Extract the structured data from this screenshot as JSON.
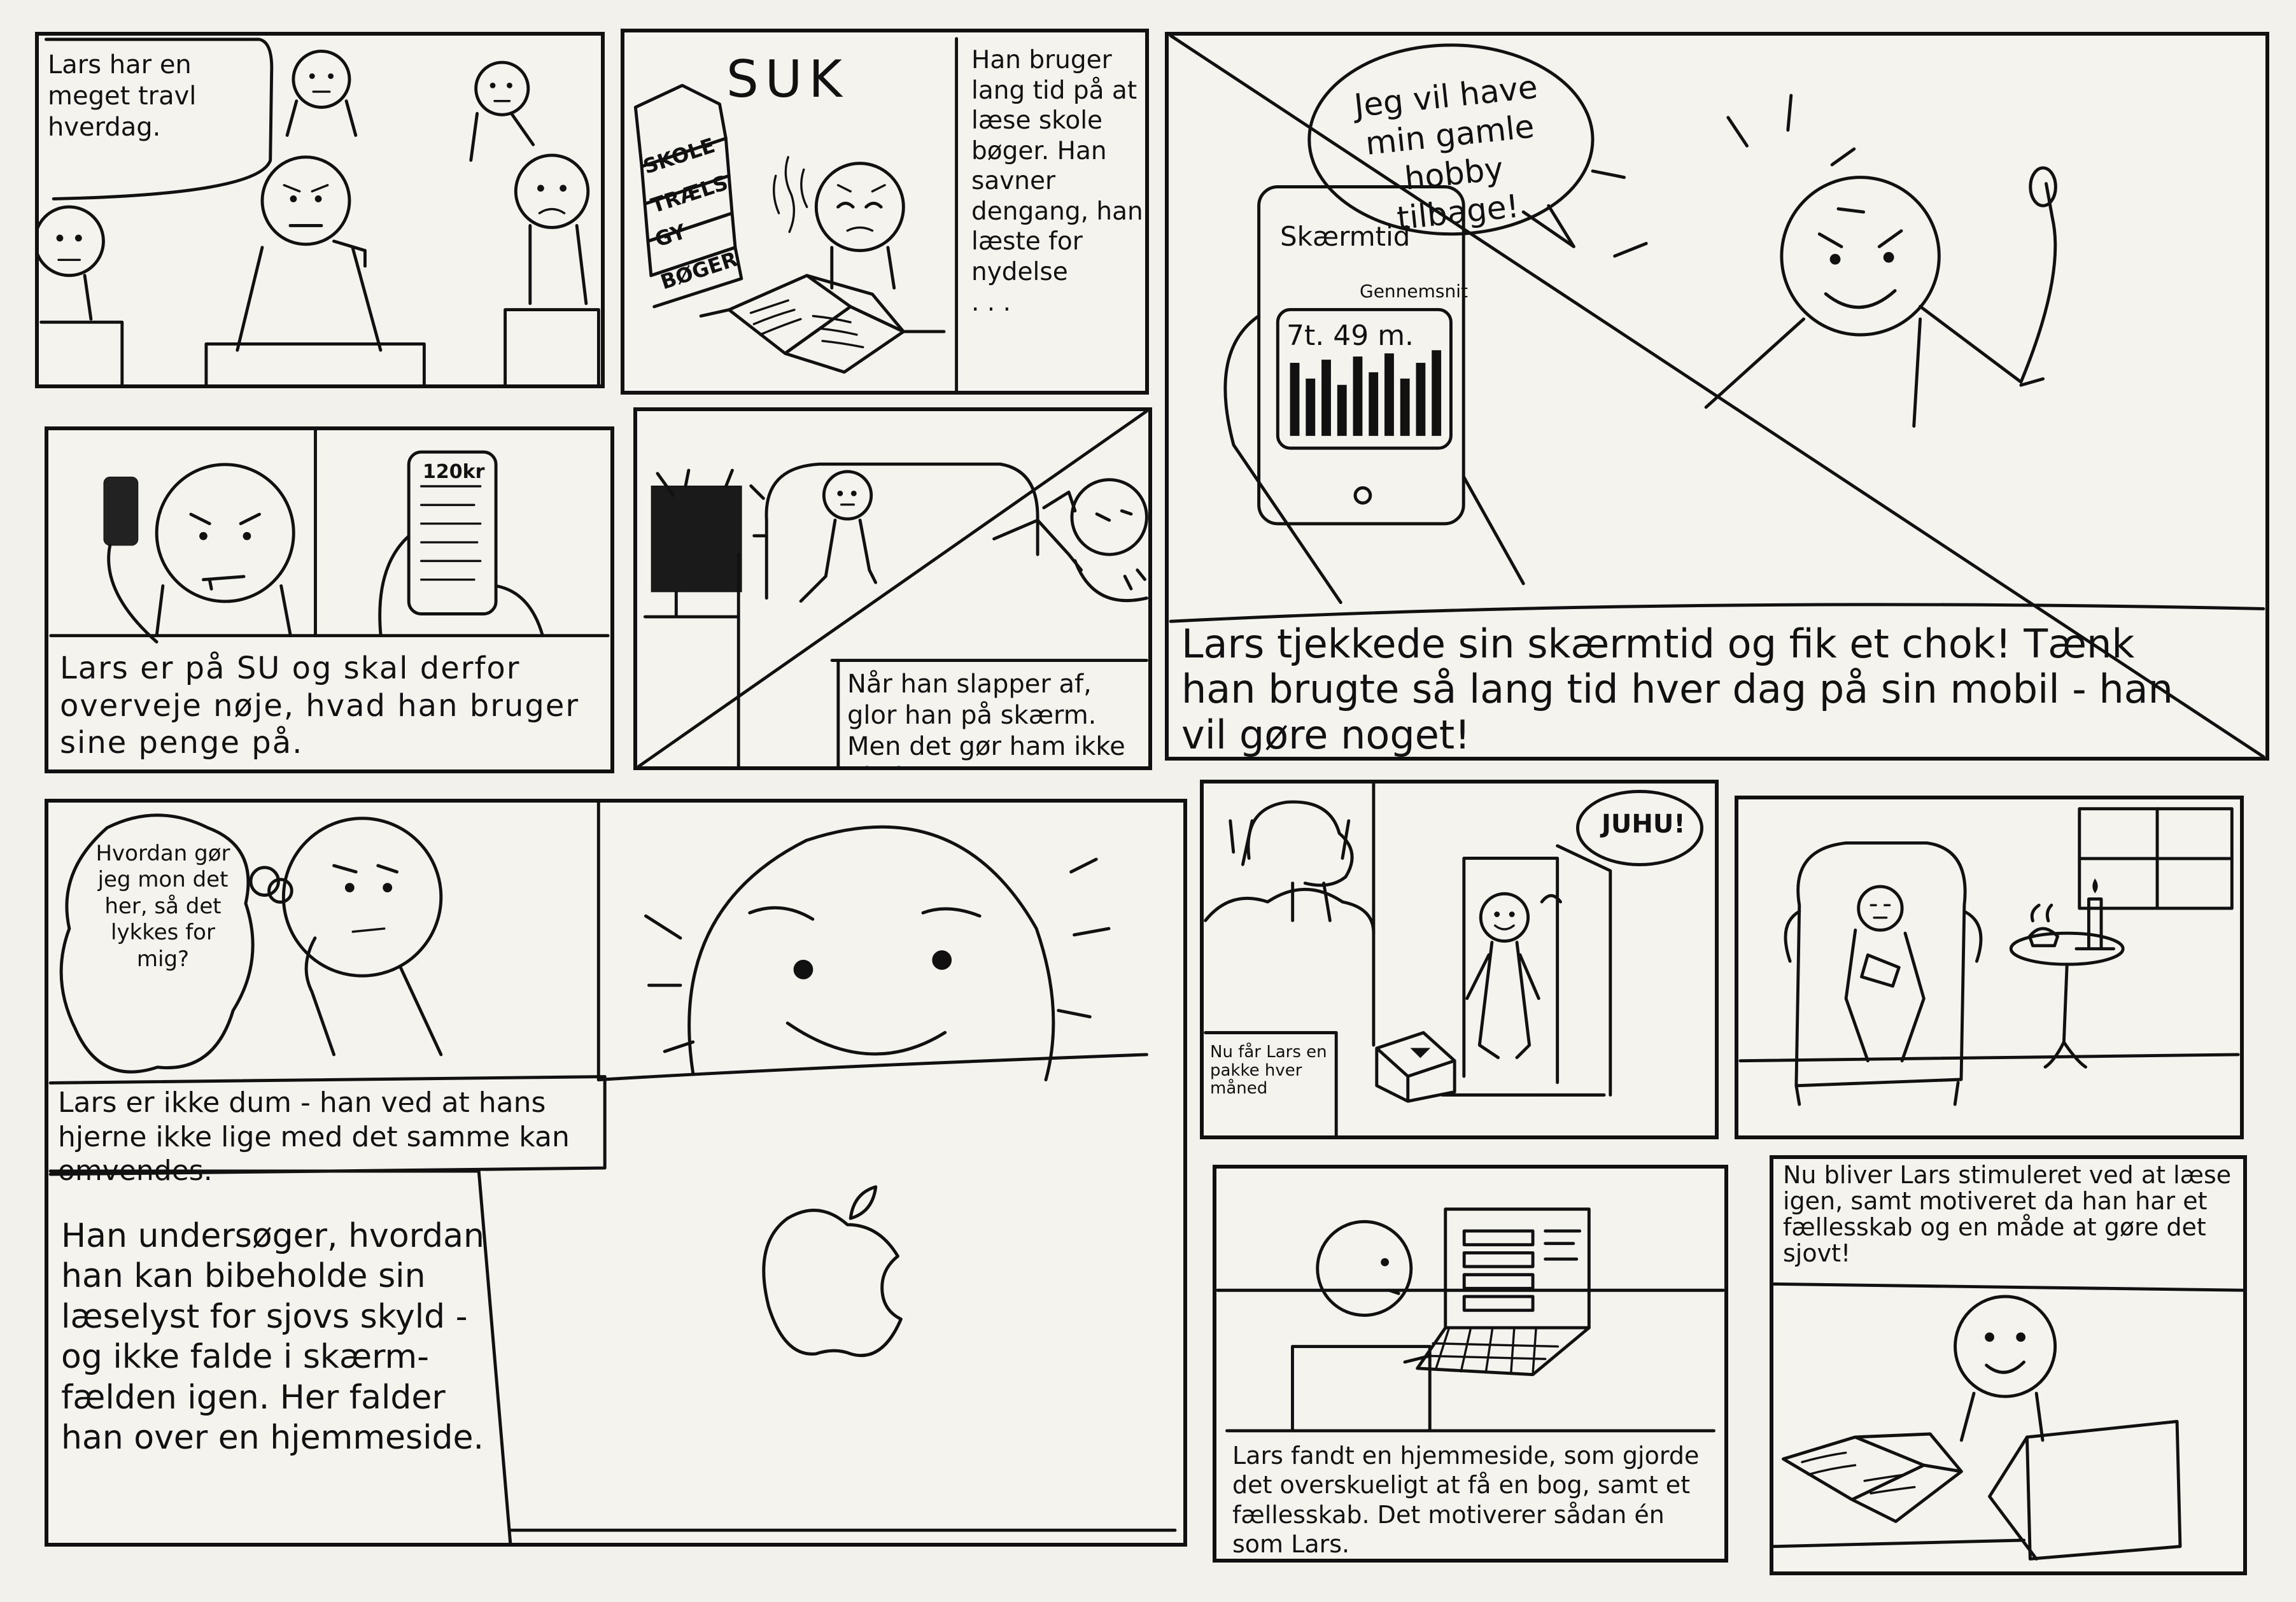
{
  "panels": {
    "p1": {
      "caption": "Lars har en meget travl hverdag."
    },
    "p2": {
      "sound": "SUK",
      "books": [
        "SKOLE",
        "TRÆLS",
        "GY",
        "BØGER"
      ],
      "caption": "Han bruger lang tid på at læse skole bøger. Han savner dengang, han læste for nydelse\n. . ."
    },
    "p3": {
      "speech": "Jeg vil have min gamle hobby tilbage!",
      "phone_title": "Skærmtid",
      "phone_sub": "Gennemsnit",
      "phone_value": "7t. 49 m.",
      "caption": "Lars tjekkede sin skærmtid og fik et chok! Tænk han brugte så lang tid hver dag på sin mobil - han vil gøre noget!"
    },
    "p4": {
      "price": "120kr",
      "caption": "Lars er på SU og skal derfor overveje nøje, hvad han bruger sine penge på."
    },
    "p5": {
      "caption": "Når han slapper af, glor han på skærm. Men det gør ham ikke glad."
    },
    "p6": {
      "thought": "Hvordan gør jeg mon det her, så det lykkes for mig?",
      "caption1": "Lars er ikke dum - han ved at hans hjerne ikke lige med det samme kan omvendes.",
      "caption2": "Han undersøger, hvordan han kan bibeholde sin læselyst for sjovs skyld - og ikke falde i skærm-fælden igen. Her falder han over en hjemmeside."
    },
    "p7": {
      "exclaim": "JUHU!",
      "caption": "Nu får Lars en pakke hver måned"
    },
    "p8": {},
    "p9": {
      "caption": "Lars fandt en hjemmeside, som gjorde det overskueligt at få en bog, samt et fællesskab. Det motiverer sådan én som Lars."
    },
    "p10": {
      "caption": "Nu bliver Lars stimuleret ved at læse igen, samt motiveret da han har et fællesskab og en måde at gøre det sjovt!"
    }
  }
}
